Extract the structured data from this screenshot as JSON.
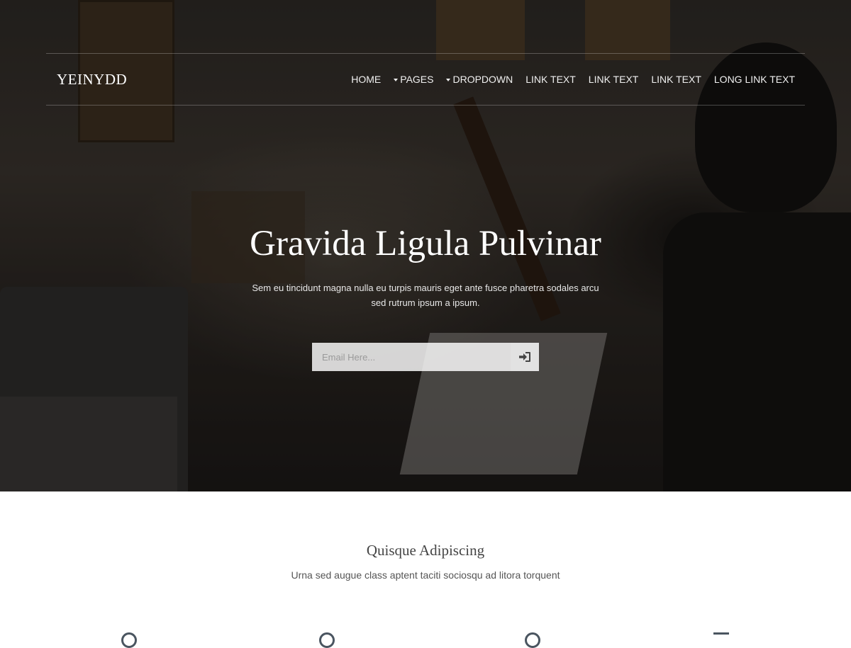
{
  "header": {
    "brand": "YEINYDD",
    "nav": [
      {
        "label": "HOME",
        "caret": false
      },
      {
        "label": "PAGES",
        "caret": true
      },
      {
        "label": "DROPDOWN",
        "caret": true
      },
      {
        "label": "LINK TEXT",
        "caret": false
      },
      {
        "label": "LINK TEXT",
        "caret": false
      },
      {
        "label": "LINK TEXT",
        "caret": false
      },
      {
        "label": "LONG LINK TEXT",
        "caret": false
      }
    ]
  },
  "hero": {
    "title": "Gravida Ligula Pulvinar",
    "subtitle": "Sem eu tincidunt magna nulla eu turpis mauris eget ante fusce pharetra sodales arcu sed rutrum ipsum a ipsum.",
    "email_placeholder": "Email Here...",
    "submit_icon": "sign-in-icon"
  },
  "section": {
    "title": "Quisque Adipiscing",
    "subtitle": "Urna sed augue class aptent taciti sociosqu ad litora torquent",
    "features": [
      "circle-icon",
      "circle-icon",
      "circle-icon",
      "square-icon"
    ]
  }
}
